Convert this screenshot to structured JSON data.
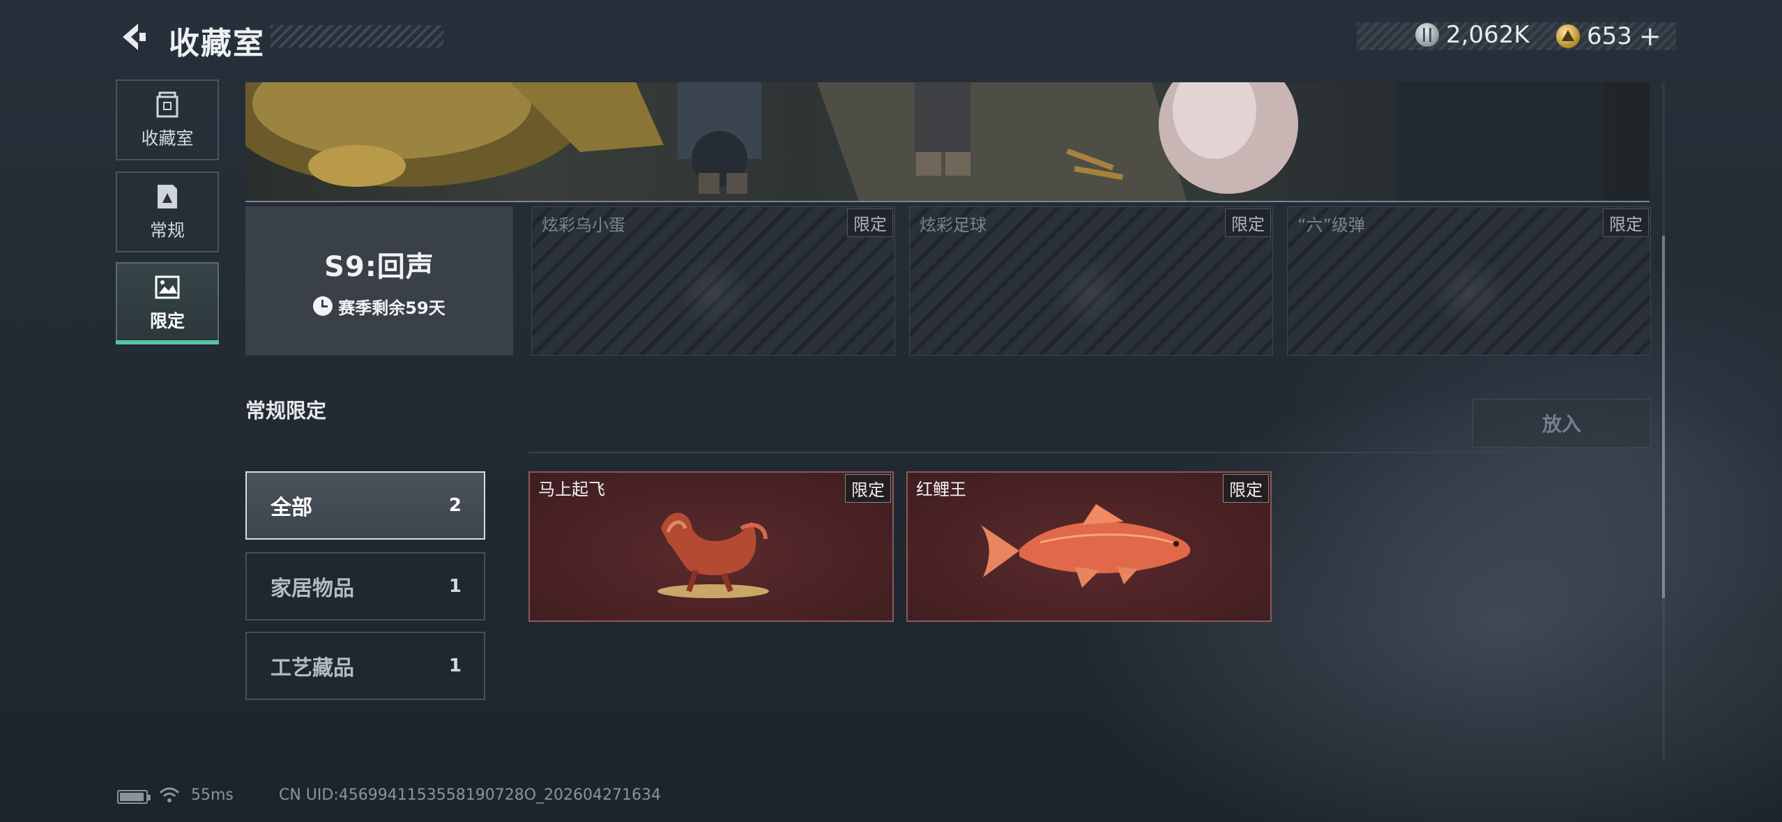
{
  "header": {
    "title": "收藏室",
    "currency": [
      {
        "icon": "silver-coin-icon",
        "value": "2,062K"
      },
      {
        "icon": "gold-coin-icon",
        "value": "653"
      }
    ],
    "add_symbol": "+"
  },
  "nav": {
    "items": [
      {
        "label": "收藏室",
        "icon": "trash-box-icon",
        "active": false
      },
      {
        "label": "常规",
        "icon": "document-icon",
        "active": false
      },
      {
        "label": "限定",
        "icon": "limited-image-icon",
        "active": true
      }
    ]
  },
  "season": {
    "title": "S9:回声",
    "remaining": "赛季剩余59天"
  },
  "locked_items": [
    {
      "name": "炫彩乌小蛋",
      "tag": "限定"
    },
    {
      "name": "炫彩足球",
      "tag": "限定"
    },
    {
      "name": "“六”级弹",
      "tag": "限定"
    }
  ],
  "section": {
    "title": "常规限定",
    "place_button": "放入"
  },
  "filters": [
    {
      "label": "全部",
      "count": "2",
      "active": true
    },
    {
      "label": "家居物品",
      "count": "1",
      "active": false
    },
    {
      "label": "工艺藏品",
      "count": "1",
      "active": false
    }
  ],
  "items": [
    {
      "name": "马上起飞",
      "tag": "限定"
    },
    {
      "name": "红鲤王",
      "tag": "限定"
    }
  ],
  "status_bar": {
    "ping": "55ms",
    "uid": "CN UID:4569941153558190728O_202604271634"
  },
  "colors": {
    "accent": "#57c6a0",
    "item_bg": "#4a2225",
    "panel_bg": "#2a3138"
  }
}
